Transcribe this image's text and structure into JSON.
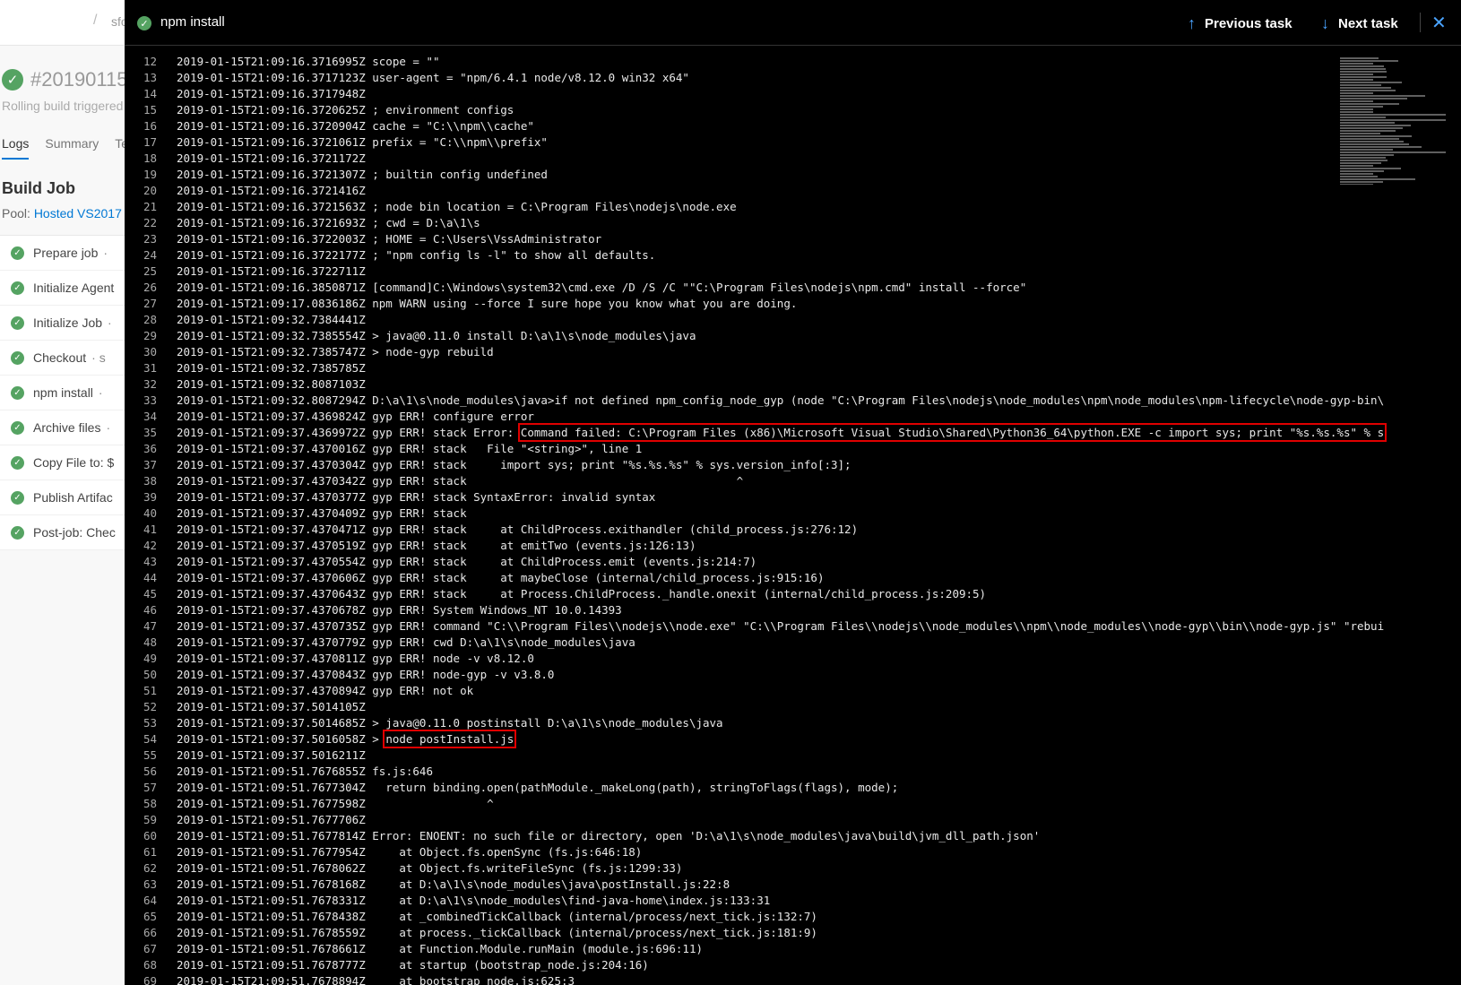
{
  "background": {
    "breadcrumb_text": "sfo",
    "build_id": "#20190115",
    "build_subtitle": "Rolling build triggered",
    "tabs": [
      "Logs",
      "Summary",
      "Te"
    ],
    "job_title": "Build Job",
    "pool_label": "Pool:",
    "pool_value": "Hosted VS2017",
    "steps": [
      {
        "label": "Prepare job",
        "suffix": "·"
      },
      {
        "label": "Initialize Agent",
        "suffix": ""
      },
      {
        "label": "Initialize Job",
        "suffix": "·"
      },
      {
        "label": "Checkout",
        "suffix": "· s"
      },
      {
        "label": "npm install",
        "suffix": "·"
      },
      {
        "label": "Archive files",
        "suffix": "·"
      },
      {
        "label": "Copy File to: $",
        "suffix": ""
      },
      {
        "label": "Publish Artifac",
        "suffix": ""
      },
      {
        "label": "Post-job: Chec",
        "suffix": ""
      }
    ]
  },
  "log_panel": {
    "task_title": "npm install",
    "previous_task_label": "Previous task",
    "next_task_label": "Next task",
    "icons": {
      "prev": "arrow-up-icon",
      "next": "arrow-down-icon",
      "close": "close-icon",
      "status": "check-circle-icon"
    },
    "colors": {
      "success": "#55a362",
      "accent": "#4aa3ff",
      "highlight": "#e00000"
    },
    "lines": [
      {
        "n": "12",
        "ts": "2019-01-15T21:09:16.3716995Z",
        "msg": "scope = \"\""
      },
      {
        "n": "13",
        "ts": "2019-01-15T21:09:16.3717123Z",
        "msg": "user-agent = \"npm/6.4.1 node/v8.12.0 win32 x64\""
      },
      {
        "n": "14",
        "ts": "2019-01-15T21:09:16.3717948Z",
        "msg": ""
      },
      {
        "n": "15",
        "ts": "2019-01-15T21:09:16.3720625Z",
        "msg": "; environment configs"
      },
      {
        "n": "16",
        "ts": "2019-01-15T21:09:16.3720904Z",
        "msg": "cache = \"C:\\\\npm\\\\cache\""
      },
      {
        "n": "17",
        "ts": "2019-01-15T21:09:16.3721061Z",
        "msg": "prefix = \"C:\\\\npm\\\\prefix\""
      },
      {
        "n": "18",
        "ts": "2019-01-15T21:09:16.3721172Z",
        "msg": ""
      },
      {
        "n": "19",
        "ts": "2019-01-15T21:09:16.3721307Z",
        "msg": "; builtin config undefined"
      },
      {
        "n": "20",
        "ts": "2019-01-15T21:09:16.3721416Z",
        "msg": ""
      },
      {
        "n": "21",
        "ts": "2019-01-15T21:09:16.3721563Z",
        "msg": "; node bin location = C:\\Program Files\\nodejs\\node.exe"
      },
      {
        "n": "22",
        "ts": "2019-01-15T21:09:16.3721693Z",
        "msg": "; cwd = D:\\a\\1\\s"
      },
      {
        "n": "23",
        "ts": "2019-01-15T21:09:16.3722003Z",
        "msg": "; HOME = C:\\Users\\VssAdministrator"
      },
      {
        "n": "24",
        "ts": "2019-01-15T21:09:16.3722177Z",
        "msg": "; \"npm config ls -l\" to show all defaults."
      },
      {
        "n": "25",
        "ts": "2019-01-15T21:09:16.3722711Z",
        "msg": ""
      },
      {
        "n": "26",
        "ts": "2019-01-15T21:09:16.3850871Z",
        "msg": "[command]C:\\Windows\\system32\\cmd.exe /D /S /C \"\"C:\\Program Files\\nodejs\\npm.cmd\" install --force\""
      },
      {
        "n": "27",
        "ts": "2019-01-15T21:09:17.0836186Z",
        "msg": "npm WARN using --force I sure hope you know what you are doing."
      },
      {
        "n": "28",
        "ts": "2019-01-15T21:09:32.7384441Z",
        "msg": ""
      },
      {
        "n": "29",
        "ts": "2019-01-15T21:09:32.7385554Z",
        "msg": "> java@0.11.0 install D:\\a\\1\\s\\node_modules\\java"
      },
      {
        "n": "30",
        "ts": "2019-01-15T21:09:32.7385747Z",
        "msg": "> node-gyp rebuild"
      },
      {
        "n": "31",
        "ts": "2019-01-15T21:09:32.7385785Z",
        "msg": ""
      },
      {
        "n": "32",
        "ts": "2019-01-15T21:09:32.8087103Z",
        "msg": ""
      },
      {
        "n": "33",
        "ts": "2019-01-15T21:09:32.8087294Z",
        "msg": "D:\\a\\1\\s\\node_modules\\java>if not defined npm_config_node_gyp (node \"C:\\Program Files\\nodejs\\node_modules\\npm\\node_modules\\npm-lifecycle\\node-gyp-bin\\"
      },
      {
        "n": "34",
        "ts": "2019-01-15T21:09:37.4369824Z",
        "msg": "gyp ERR! configure error"
      },
      {
        "n": "35",
        "ts": "2019-01-15T21:09:37.4369972Z",
        "msg": "gyp ERR! stack Error: ",
        "hl": "Command failed: C:\\Program Files (x86)\\Microsoft Visual Studio\\Shared\\Python36_64\\python.EXE -c import sys; print \"%s.%s.%s\" % s"
      },
      {
        "n": "36",
        "ts": "2019-01-15T21:09:37.4370016Z",
        "msg": "gyp ERR! stack   File \"<string>\", line 1"
      },
      {
        "n": "37",
        "ts": "2019-01-15T21:09:37.4370304Z",
        "msg": "gyp ERR! stack     import sys; print \"%s.%s.%s\" % sys.version_info[:3];"
      },
      {
        "n": "38",
        "ts": "2019-01-15T21:09:37.4370342Z",
        "msg": "gyp ERR! stack                                        ^"
      },
      {
        "n": "39",
        "ts": "2019-01-15T21:09:37.4370377Z",
        "msg": "gyp ERR! stack SyntaxError: invalid syntax"
      },
      {
        "n": "40",
        "ts": "2019-01-15T21:09:37.4370409Z",
        "msg": "gyp ERR! stack"
      },
      {
        "n": "41",
        "ts": "2019-01-15T21:09:37.4370471Z",
        "msg": "gyp ERR! stack     at ChildProcess.exithandler (child_process.js:276:12)"
      },
      {
        "n": "42",
        "ts": "2019-01-15T21:09:37.4370519Z",
        "msg": "gyp ERR! stack     at emitTwo (events.js:126:13)"
      },
      {
        "n": "43",
        "ts": "2019-01-15T21:09:37.4370554Z",
        "msg": "gyp ERR! stack     at ChildProcess.emit (events.js:214:7)"
      },
      {
        "n": "44",
        "ts": "2019-01-15T21:09:37.4370606Z",
        "msg": "gyp ERR! stack     at maybeClose (internal/child_process.js:915:16)"
      },
      {
        "n": "45",
        "ts": "2019-01-15T21:09:37.4370643Z",
        "msg": "gyp ERR! stack     at Process.ChildProcess._handle.onexit (internal/child_process.js:209:5)"
      },
      {
        "n": "46",
        "ts": "2019-01-15T21:09:37.4370678Z",
        "msg": "gyp ERR! System Windows_NT 10.0.14393"
      },
      {
        "n": "47",
        "ts": "2019-01-15T21:09:37.4370735Z",
        "msg": "gyp ERR! command \"C:\\\\Program Files\\\\nodejs\\\\node.exe\" \"C:\\\\Program Files\\\\nodejs\\\\node_modules\\\\npm\\\\node_modules\\\\node-gyp\\\\bin\\\\node-gyp.js\" \"rebui"
      },
      {
        "n": "48",
        "ts": "2019-01-15T21:09:37.4370779Z",
        "msg": "gyp ERR! cwd D:\\a\\1\\s\\node_modules\\java"
      },
      {
        "n": "49",
        "ts": "2019-01-15T21:09:37.4370811Z",
        "msg": "gyp ERR! node -v v8.12.0"
      },
      {
        "n": "50",
        "ts": "2019-01-15T21:09:37.4370843Z",
        "msg": "gyp ERR! node-gyp -v v3.8.0"
      },
      {
        "n": "51",
        "ts": "2019-01-15T21:09:37.4370894Z",
        "msg": "gyp ERR! not ok"
      },
      {
        "n": "52",
        "ts": "2019-01-15T21:09:37.5014105Z",
        "msg": ""
      },
      {
        "n": "53",
        "ts": "2019-01-15T21:09:37.5014685Z",
        "msg": "> java@0.11.0 postinstall D:\\a\\1\\s\\node_modules\\java"
      },
      {
        "n": "54",
        "ts": "2019-01-15T21:09:37.5016058Z",
        "msg": "> ",
        "hl": "node postInstall.js"
      },
      {
        "n": "55",
        "ts": "2019-01-15T21:09:37.5016211Z",
        "msg": ""
      },
      {
        "n": "56",
        "ts": "2019-01-15T21:09:51.7676855Z",
        "msg": "fs.js:646"
      },
      {
        "n": "57",
        "ts": "2019-01-15T21:09:51.7677304Z",
        "msg": "  return binding.open(pathModule._makeLong(path), stringToFlags(flags), mode);"
      },
      {
        "n": "58",
        "ts": "2019-01-15T21:09:51.7677598Z",
        "msg": "                 ^"
      },
      {
        "n": "59",
        "ts": "2019-01-15T21:09:51.7677706Z",
        "msg": ""
      },
      {
        "n": "60",
        "ts": "2019-01-15T21:09:51.7677814Z",
        "msg": "Error: ENOENT: no such file or directory, open 'D:\\a\\1\\s\\node_modules\\java\\build\\jvm_dll_path.json'"
      },
      {
        "n": "61",
        "ts": "2019-01-15T21:09:51.7677954Z",
        "msg": "    at Object.fs.openSync (fs.js:646:18)"
      },
      {
        "n": "62",
        "ts": "2019-01-15T21:09:51.7678062Z",
        "msg": "    at Object.fs.writeFileSync (fs.js:1299:33)"
      },
      {
        "n": "63",
        "ts": "2019-01-15T21:09:51.7678168Z",
        "msg": "    at D:\\a\\1\\s\\node_modules\\java\\postInstall.js:22:8"
      },
      {
        "n": "64",
        "ts": "2019-01-15T21:09:51.7678331Z",
        "msg": "    at D:\\a\\1\\s\\node_modules\\find-java-home\\index.js:133:31"
      },
      {
        "n": "65",
        "ts": "2019-01-15T21:09:51.7678438Z",
        "msg": "    at _combinedTickCallback (internal/process/next_tick.js:132:7)"
      },
      {
        "n": "66",
        "ts": "2019-01-15T21:09:51.7678559Z",
        "msg": "    at process._tickCallback (internal/process/next_tick.js:181:9)"
      },
      {
        "n": "67",
        "ts": "2019-01-15T21:09:51.7678661Z",
        "msg": "    at Function.Module.runMain (module.js:696:11)"
      },
      {
        "n": "68",
        "ts": "2019-01-15T21:09:51.7678777Z",
        "msg": "    at startup (bootstrap_node.js:204:16)"
      },
      {
        "n": "69",
        "ts": "2019-01-15T21:09:51.7678894Z",
        "msg": "    at bootstrap_node.js:625:3"
      }
    ]
  }
}
